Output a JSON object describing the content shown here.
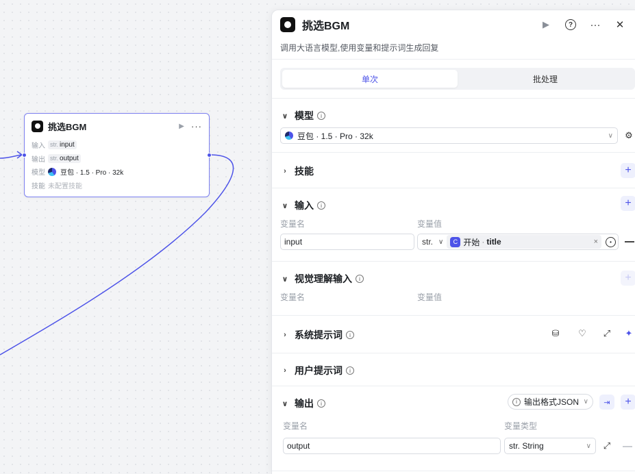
{
  "node": {
    "title": "挑选BGM",
    "input_label": "输入",
    "input_type": "str.",
    "input_name": "input",
    "output_label": "输出",
    "output_type": "str.",
    "output_name": "output",
    "model_label": "模型",
    "model_value": "豆包 · 1.5 · Pro · 32k",
    "skill_label": "技能",
    "skill_value": "未配置技能"
  },
  "panel": {
    "title": "挑选BGM",
    "description": "调用大语言模型,使用变量和提示词生成回复",
    "tabs": [
      {
        "label": "单次",
        "active": true
      },
      {
        "label": "批处理",
        "active": false
      }
    ],
    "model": {
      "heading": "模型",
      "selected": "豆包 · 1.5 · Pro · 32k"
    },
    "skills": {
      "heading": "技能"
    },
    "input": {
      "heading": "输入",
      "col_name": "变量名",
      "col_value": "变量值",
      "row": {
        "name": "input",
        "type": "str.",
        "source_node": "开始",
        "source_var": "title"
      }
    },
    "visual_input": {
      "heading": "视觉理解输入",
      "col_name": "变量名",
      "col_value": "变量值"
    },
    "system_prompt": {
      "heading": "系统提示词"
    },
    "user_prompt": {
      "heading": "用户提示词"
    },
    "output": {
      "heading": "输出",
      "format_label": "输出格式JSON",
      "col_name": "变量名",
      "col_type": "变量类型",
      "row": {
        "name": "output",
        "type": "str. String"
      }
    }
  },
  "colors": {
    "accent": "#4d53e8",
    "edge": "#4d53e8"
  }
}
